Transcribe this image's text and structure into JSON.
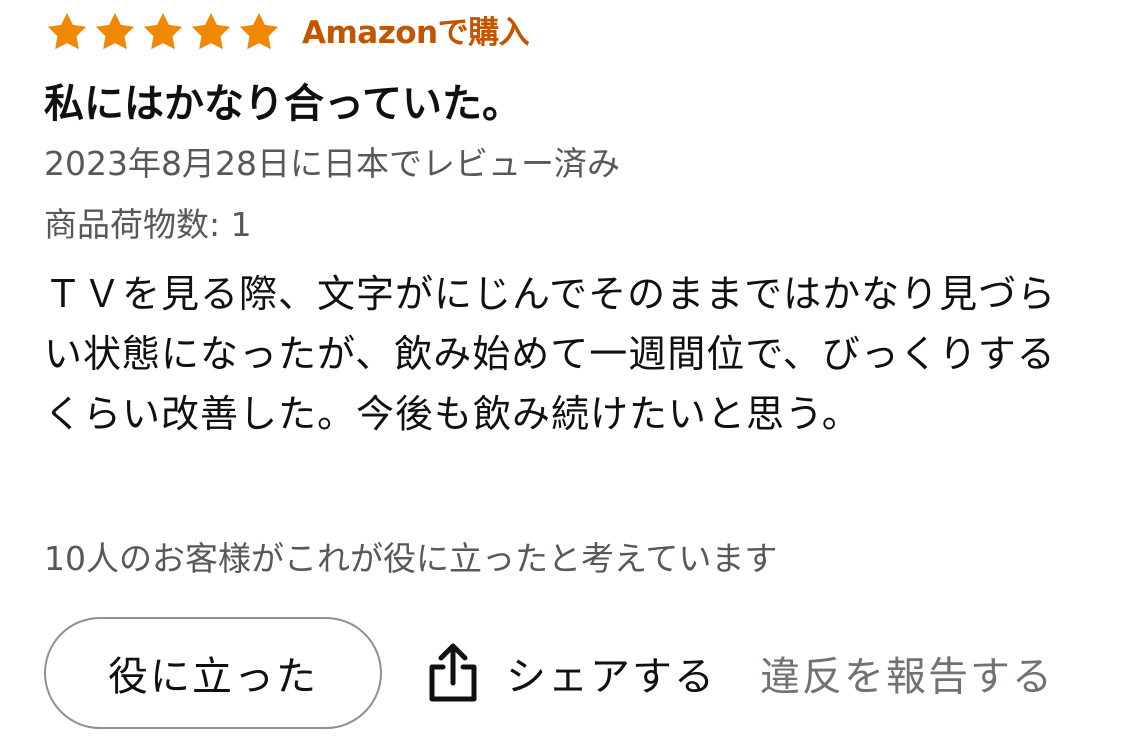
{
  "review": {
    "rating": 5,
    "rating_max": 5,
    "star_color": "#f08804",
    "badge": "Amazonで購入",
    "title": "私にはかなり合っていた。",
    "date_line": "2023年8月28日に日本でレビュー済み",
    "item_count": "商品荷物数: 1",
    "body": "ＴＶを見る際、文字がにじんでそのままではかなり見づらい状態になったが、飲み始めて一週間位で、びっくりするくらい改善した。今後も飲み続けたいと思う。",
    "helpful_count": "10人のお客様がこれが役に立ったと考えています"
  },
  "actions": {
    "helpful_label": "役に立った",
    "share_icon": "share-icon",
    "share_label": "シェアする",
    "report_label": "違反を報告する"
  }
}
